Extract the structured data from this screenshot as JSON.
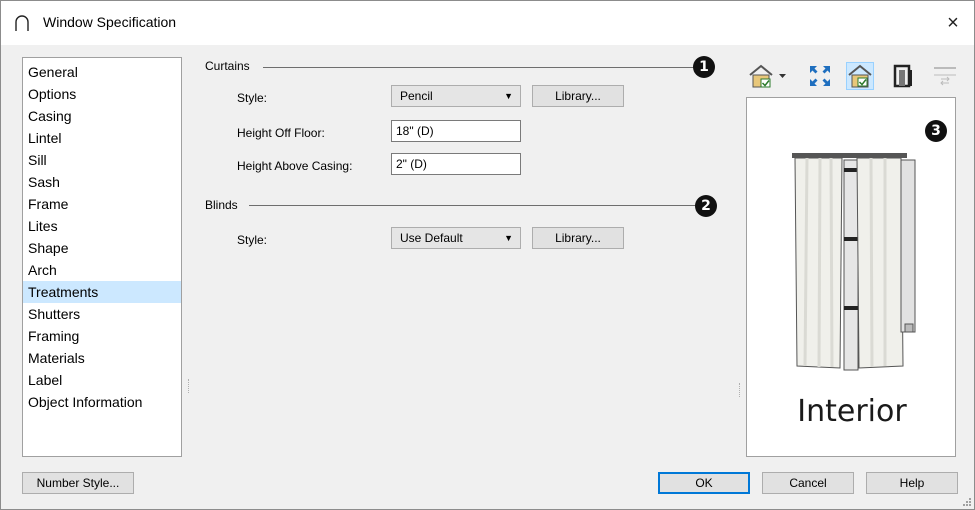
{
  "window": {
    "title": "Window Specification",
    "close": "×"
  },
  "categories": [
    "General",
    "Options",
    "Casing",
    "Lintel",
    "Sill",
    "Sash",
    "Frame",
    "Lites",
    "Shape",
    "Arch",
    "Treatments",
    "Shutters",
    "Framing",
    "Materials",
    "Label",
    "Object Information"
  ],
  "selected_category": "Treatments",
  "curtains": {
    "section_label": "Curtains",
    "callout": "1",
    "style_label": "Style:",
    "style_value": "Pencil",
    "library_label": "Library...",
    "height_off_floor_label": "Height Off Floor:",
    "height_off_floor_value": "18\" (D)",
    "height_above_casing_label": "Height Above Casing:",
    "height_above_casing_value": "2\" (D)"
  },
  "blinds": {
    "section_label": "Blinds",
    "callout": "2",
    "style_label": "Style:",
    "style_value": "Use Default",
    "library_label": "Library..."
  },
  "preview": {
    "callout": "3",
    "label": "Interior"
  },
  "toolbar": [
    "camera-view-dropdown-icon",
    "fit-view-icon",
    "plan-view-toggle-icon",
    "doorframe-icon",
    "swap-icon"
  ],
  "buttons": {
    "number_style": "Number Style...",
    "ok": "OK",
    "cancel": "Cancel",
    "help": "Help"
  },
  "colors": {
    "selection": "#cce8ff",
    "primary_border": "#0078d7"
  }
}
